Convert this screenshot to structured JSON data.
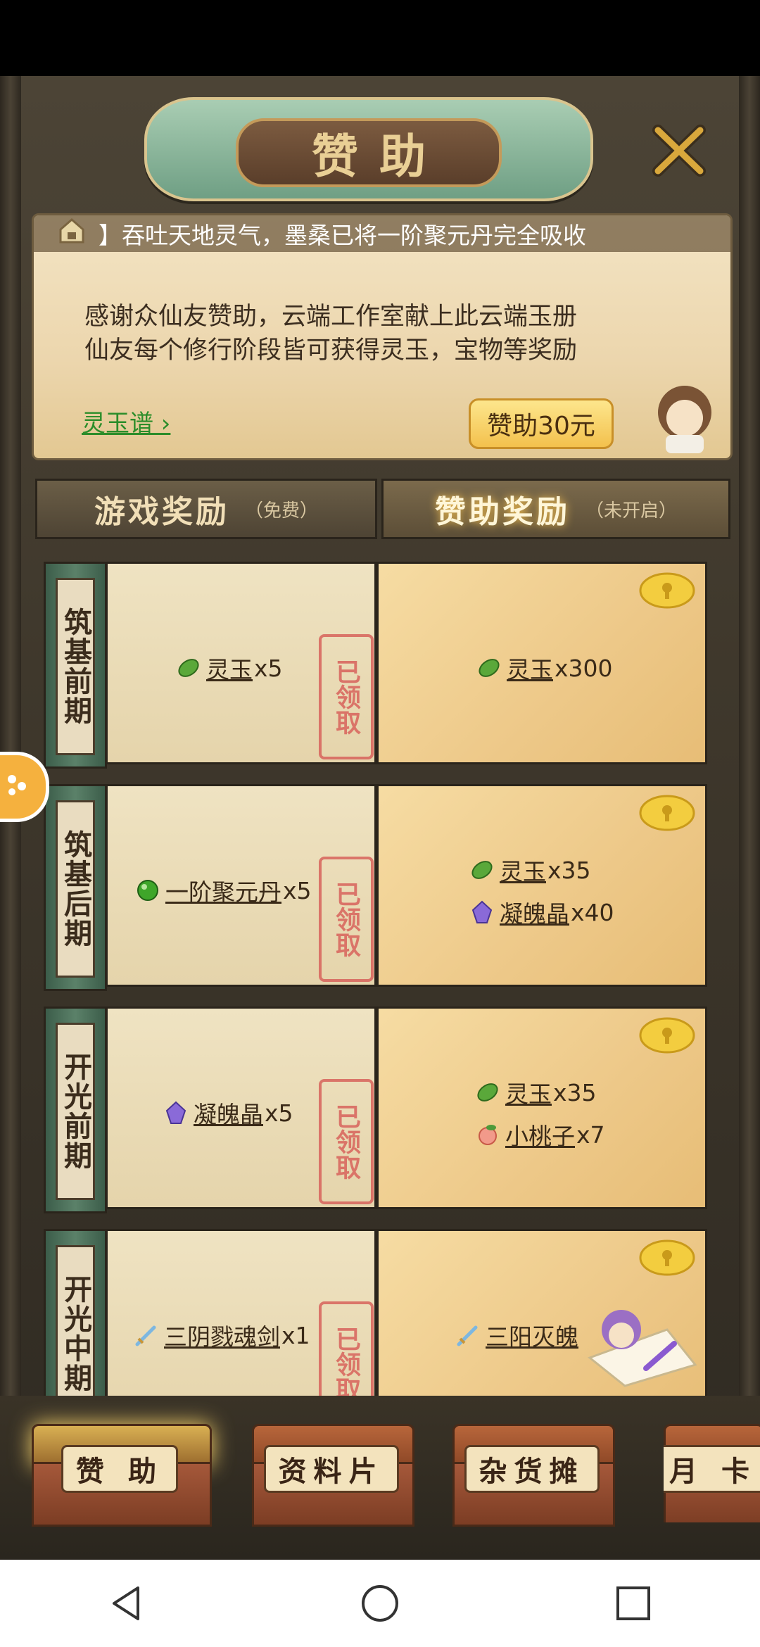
{
  "title": "赞助",
  "ticker": {
    "text": "】吞吐天地灵气，墨桑已将一阶聚元丹完全吸收"
  },
  "panel": {
    "line1": "感谢众仙友赞助，云端工作室献上此云端玉册",
    "line2": "仙友每个修行阶段皆可获得灵玉，宝物等奖励",
    "link": "灵玉谱",
    "sponsor_button": "赞助30元"
  },
  "tabs": {
    "game": {
      "label": "游戏奖励",
      "note": "（免费）"
    },
    "sponsor": {
      "label": "赞助奖励",
      "note": "（未开启）"
    }
  },
  "stamp": "已领取",
  "rows": [
    {
      "stage": "筑基前期",
      "free": [
        {
          "name": "灵玉",
          "qty": "x5",
          "icon": "jade-leaf-icon"
        }
      ],
      "paid": [
        {
          "name": "灵玉",
          "qty": "x300",
          "icon": "jade-leaf-icon"
        }
      ]
    },
    {
      "stage": "筑基后期",
      "free": [
        {
          "name": "一阶聚元丹",
          "qty": "x5",
          "icon": "green-pill-icon"
        }
      ],
      "paid": [
        {
          "name": "灵玉",
          "qty": "x35",
          "icon": "jade-leaf-icon"
        },
        {
          "name": "凝魄晶",
          "qty": "x40",
          "icon": "crystal-icon"
        }
      ]
    },
    {
      "stage": "开光前期",
      "free": [
        {
          "name": "凝魄晶",
          "qty": "x5",
          "icon": "crystal-icon"
        }
      ],
      "paid": [
        {
          "name": "灵玉",
          "qty": "x35",
          "icon": "jade-leaf-icon"
        },
        {
          "name": "小桃子",
          "qty": "x7",
          "icon": "peach-icon"
        }
      ]
    },
    {
      "stage": "开光中期",
      "free": [
        {
          "name": "三阴戮魂剑",
          "qty": "x1",
          "icon": "sword-icon"
        }
      ],
      "paid": [
        {
          "name": "三阳灭魄",
          "qty": "",
          "icon": "sword-icon"
        }
      ]
    }
  ],
  "bottom_nav": [
    {
      "label": "赞 助",
      "active": true
    },
    {
      "label": "资料片",
      "active": false
    },
    {
      "label": "杂货摊",
      "active": false
    },
    {
      "label": "月 卡",
      "active": false
    }
  ],
  "colors": {
    "accent_green": "#2b8d2a",
    "stamp_red": "#d8635c",
    "gold": "#f3c14d"
  }
}
